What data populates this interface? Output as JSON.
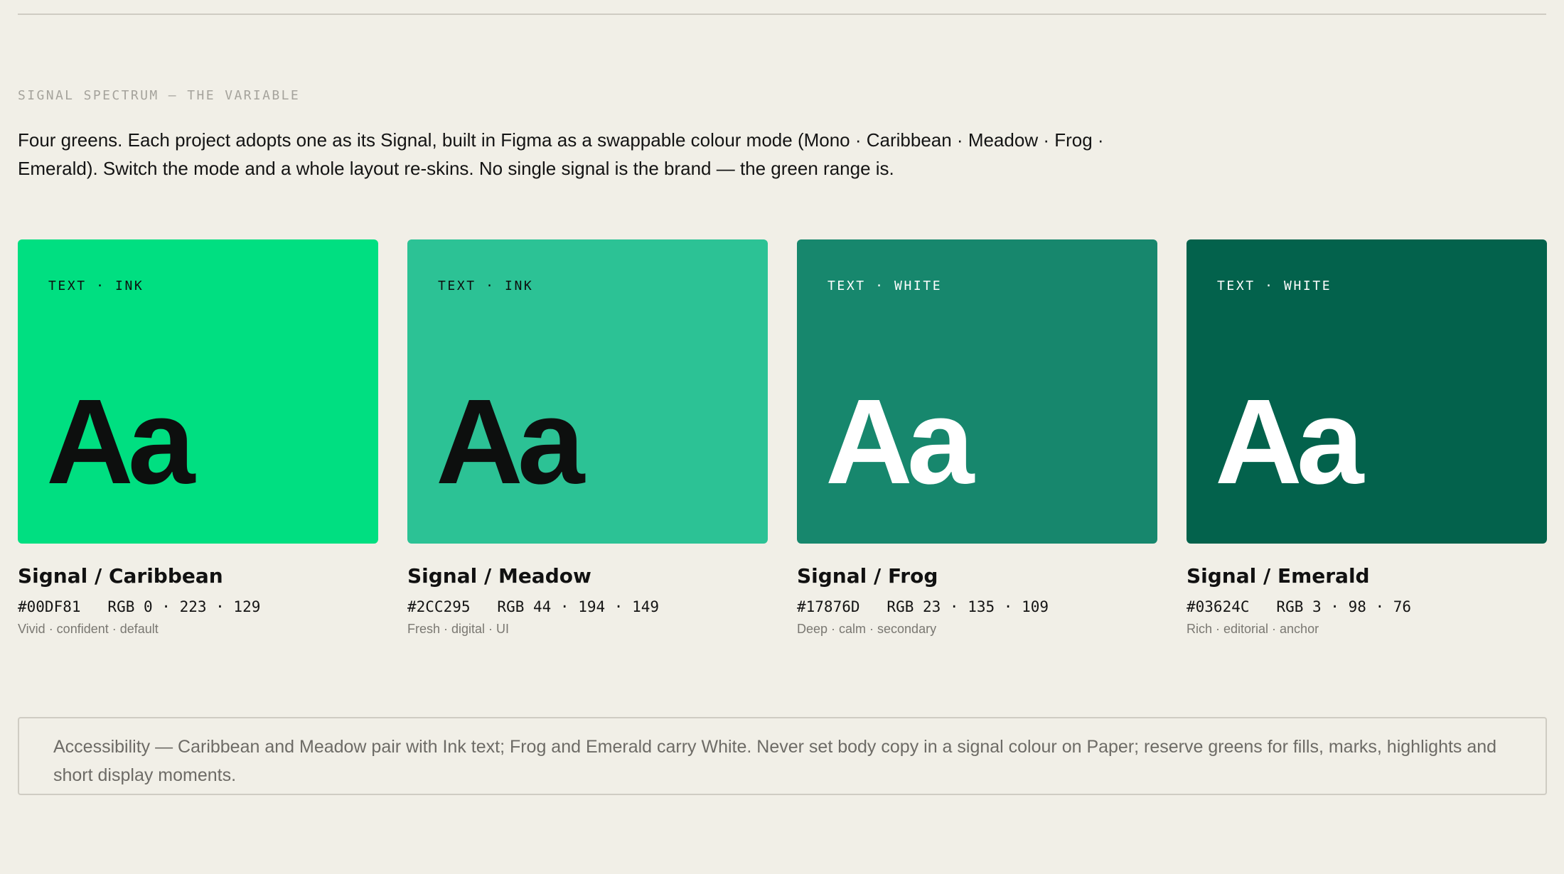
{
  "section": {
    "eyebrow": "SIGNAL SPECTRUM — THE VARIABLE",
    "intro": "Four greens. Each project adopts one as its Signal, built in Figma as a swappable colour mode (Mono · Caribbean · Meadow · Frog · Emerald). Switch the mode and a whole layout re-skins. No single signal is the brand — the green range is."
  },
  "signals": [
    {
      "tag": "TEXT · INK",
      "sample": "Aa",
      "title": "Signal / Caribbean",
      "codes": "#00DF81   RGB 0 · 223 · 129",
      "desc": "Vivid · confident · default",
      "color": "#00DF81",
      "text_color": "#0D0F0E"
    },
    {
      "tag": "TEXT · INK",
      "sample": "Aa",
      "title": "Signal / Meadow",
      "codes": "#2CC295   RGB 44 · 194 · 149",
      "desc": "Fresh · digital · UI",
      "color": "#2CC295",
      "text_color": "#0D0F0E"
    },
    {
      "tag": "TEXT · WHITE",
      "sample": "Aa",
      "title": "Signal / Frog",
      "codes": "#17876D   RGB 23 · 135 · 109",
      "desc": "Deep · calm · secondary",
      "color": "#17876D",
      "text_color": "#FFFFFF"
    },
    {
      "tag": "TEXT · WHITE",
      "sample": "Aa",
      "title": "Signal / Emerald",
      "codes": "#03624C   RGB 3 · 98 · 76",
      "desc": "Rich · editorial · anchor",
      "color": "#03624C",
      "text_color": "#FFFFFF"
    }
  ],
  "note": {
    "text": "Accessibility — Caribbean and Meadow pair with Ink text; Frog and Emerald carry White. Never set body copy in a signal colour on Paper; reserve greens for fills, marks, highlights and short display moments."
  }
}
